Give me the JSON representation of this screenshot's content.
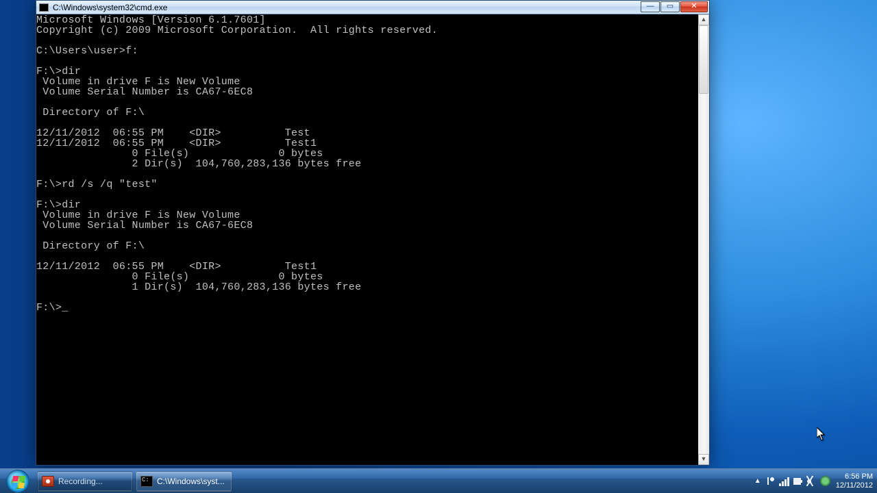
{
  "window": {
    "title": "C:\\Windows\\system32\\cmd.exe"
  },
  "console": {
    "l1": "Microsoft Windows [Version 6.1.7601]",
    "l2": "Copyright (c) 2009 Microsoft Corporation.  All rights reserved.",
    "l3": "",
    "l4": "C:\\Users\\user>f:",
    "l5": "",
    "l6": "F:\\>dir",
    "l7": " Volume in drive F is New Volume",
    "l8": " Volume Serial Number is CA67-6EC8",
    "l9": "",
    "l10": " Directory of F:\\",
    "l11": "",
    "l12": "12/11/2012  06:55 PM    <DIR>          Test",
    "l13": "12/11/2012  06:55 PM    <DIR>          Test1",
    "l14": "               0 File(s)              0 bytes",
    "l15": "               2 Dir(s)  104,760,283,136 bytes free",
    "l16": "",
    "l17": "F:\\>rd /s /q \"test\"",
    "l18": "",
    "l19": "F:\\>dir",
    "l20": " Volume in drive F is New Volume",
    "l21": " Volume Serial Number is CA67-6EC8",
    "l22": "",
    "l23": " Directory of F:\\",
    "l24": "",
    "l25": "12/11/2012  06:55 PM    <DIR>          Test1",
    "l26": "               0 File(s)              0 bytes",
    "l27": "               1 Dir(s)  104,760,283,136 bytes free",
    "l28": "",
    "prompt": "F:\\>"
  },
  "taskbar": {
    "item1": "Recording...",
    "item2": "C:\\Windows\\syst..."
  },
  "clock": {
    "time": "6:56 PM",
    "date": "12/11/2012"
  }
}
